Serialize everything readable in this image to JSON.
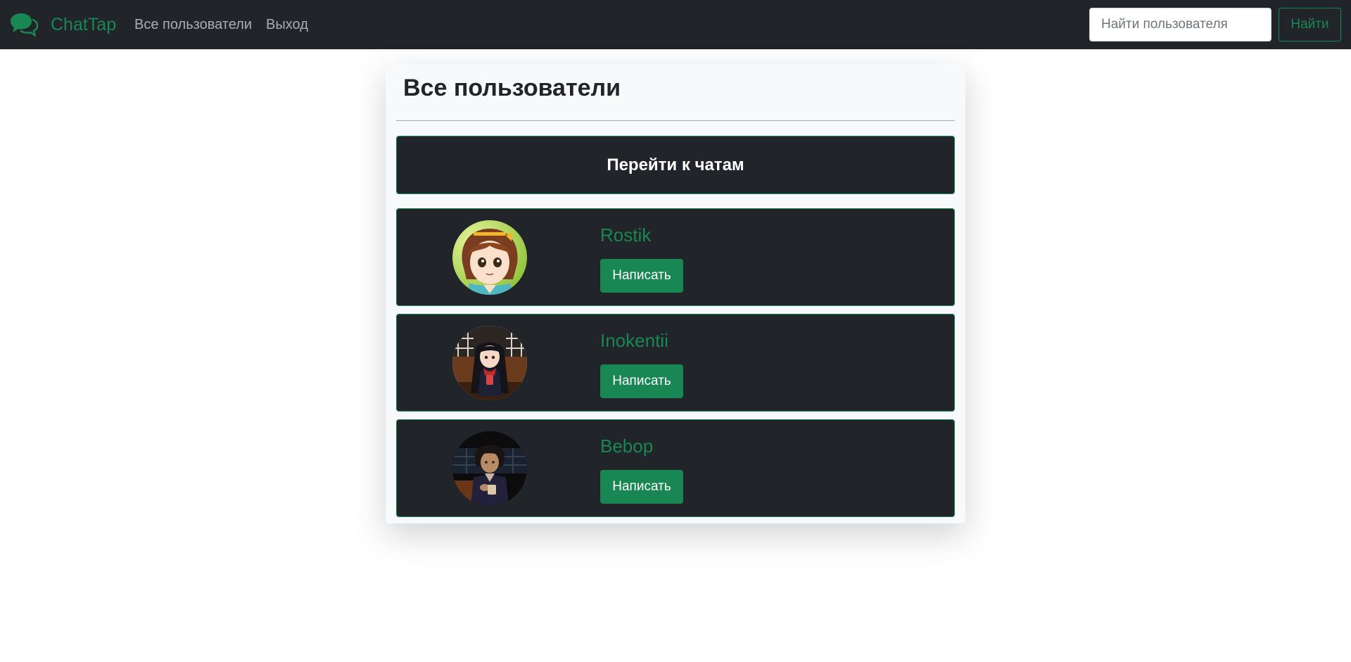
{
  "navbar": {
    "brand": "ChatTap",
    "brand_icon": "chat-bubbles-icon",
    "links": [
      {
        "label": "Все пользователи"
      },
      {
        "label": "Выход"
      }
    ],
    "search": {
      "placeholder": "Найти пользователя",
      "value": "",
      "button_label": "Найти"
    }
  },
  "main": {
    "title": "Все пользователи",
    "chats_button": "Перейти к чатам",
    "users": [
      {
        "name": "Rostik",
        "action": "Написать"
      },
      {
        "name": "Inokentii",
        "action": "Написать"
      },
      {
        "name": "Bebop",
        "action": "Написать"
      }
    ]
  },
  "colors": {
    "navbar_bg": "#212529",
    "accent": "#198754",
    "card_bg": "#f8f9fa",
    "text_dark": "#212529"
  }
}
